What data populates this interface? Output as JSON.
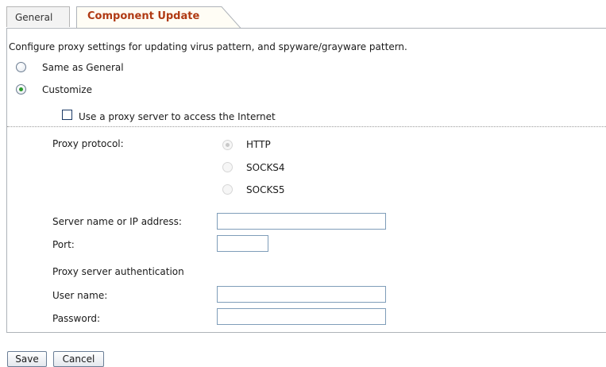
{
  "tabs": [
    {
      "label": "General",
      "active": false
    },
    {
      "label": "Component Update",
      "active": true
    }
  ],
  "description": "Configure proxy settings for updating virus pattern, and spyware/grayware pattern.",
  "mode_options": [
    {
      "label": "Same as General",
      "selected": false
    },
    {
      "label": "Customize",
      "selected": true
    }
  ],
  "use_proxy": {
    "label": "Use a proxy server to access the Internet",
    "checked": false
  },
  "proxy_protocol": {
    "label": "Proxy protocol:",
    "options": [
      {
        "label": "HTTP",
        "selected": true
      },
      {
        "label": "SOCKS4",
        "selected": false
      },
      {
        "label": "SOCKS5",
        "selected": false
      }
    ]
  },
  "server": {
    "label": "Server name or IP address:",
    "value": ""
  },
  "port": {
    "label": "Port:",
    "value": ""
  },
  "auth": {
    "heading": "Proxy server authentication"
  },
  "username": {
    "label": "User name:",
    "value": ""
  },
  "password": {
    "label": "Password:",
    "value": ""
  },
  "buttons": {
    "save": "Save",
    "cancel": "Cancel"
  },
  "colors": {
    "active_tab_text": "#b03a13",
    "active_tab_bg": "#fffdf5",
    "radio_dot": "#2a9a2a"
  }
}
